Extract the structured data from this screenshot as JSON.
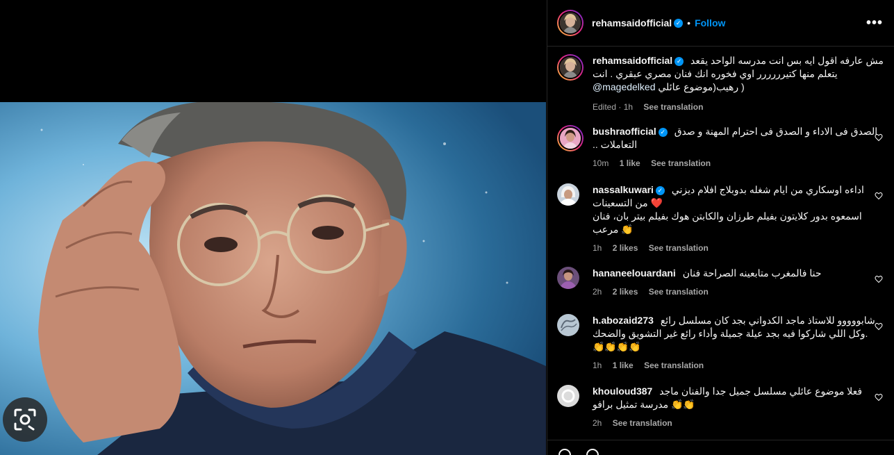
{
  "post": {
    "username": "rehamsaidofficial",
    "follow_label": "Follow",
    "dot": "•",
    "more": "•••"
  },
  "caption": {
    "username": "rehamsaidofficial",
    "line1": "مش عارفه اقول ايه بس انت مدرسه الواحد يقعد",
    "line2": "يتعلم منها كتيرررررر اوي فخوره انك فنان مصري عبقري . انت",
    "line3_a": "( رهيب(موضوع عائلي",
    "mention": "@magedelked",
    "time": "Edited · 1h",
    "see_translation": "See translation"
  },
  "comments": [
    {
      "username": "bushraofficial",
      "verified": true,
      "lines": [
        "الصدق فى الاداء و الصدق فى احترام المهنة و صدق",
        "التعاملات .."
      ],
      "time": "10m",
      "likes": "1 like",
      "see_translation": "See translation"
    },
    {
      "username": "nassalkuwari",
      "verified": true,
      "lines": [
        "اداءه اوسكاري من ايام شغله بدوبلاج افلام ديزني",
        "❤️ من التسعينات",
        "اسمعوه بدور كلايتون بفيلم طرزان والكابتن هوك بفيلم بيتر بان، فنان",
        "👏 مرعب"
      ],
      "time": "1h",
      "likes": "2 likes",
      "see_translation": "See translation"
    },
    {
      "username": "hananeelouardani",
      "verified": false,
      "lines": [
        "حنا فالمغرب متابعينه الصراحة فنان"
      ],
      "time": "2h",
      "likes": "2 likes",
      "see_translation": "See translation"
    },
    {
      "username": "h.abozaid273",
      "verified": false,
      "lines": [
        "شابووووو للاستاذ ماجد الكدواني بجد كان مسلسل رائع",
        ".وكل اللي شاركوا فيه بجد عيلة جميلة وأداء رائع غير التشويق والضحك",
        "👏👏👏👏"
      ],
      "time": "1h",
      "likes": "1 like",
      "see_translation": "See translation"
    },
    {
      "username": "khouloud387",
      "verified": false,
      "lines": [
        "فعلا موضوع عائلي مسلسل جميل جدا والفنان ماجد",
        "👏👏 مدرسة تمثيل برافو"
      ],
      "time": "2h",
      "likes": "",
      "see_translation": "See translation"
    }
  ],
  "colors": {
    "accent": "#0095f6",
    "background": "#000000",
    "text": "#f5f5f5",
    "muted": "#a8a8a8",
    "heart": "#ff3040"
  },
  "icons": [
    "verified-badge-icon",
    "more-options-icon",
    "heart-icon",
    "visual-search-icon"
  ]
}
